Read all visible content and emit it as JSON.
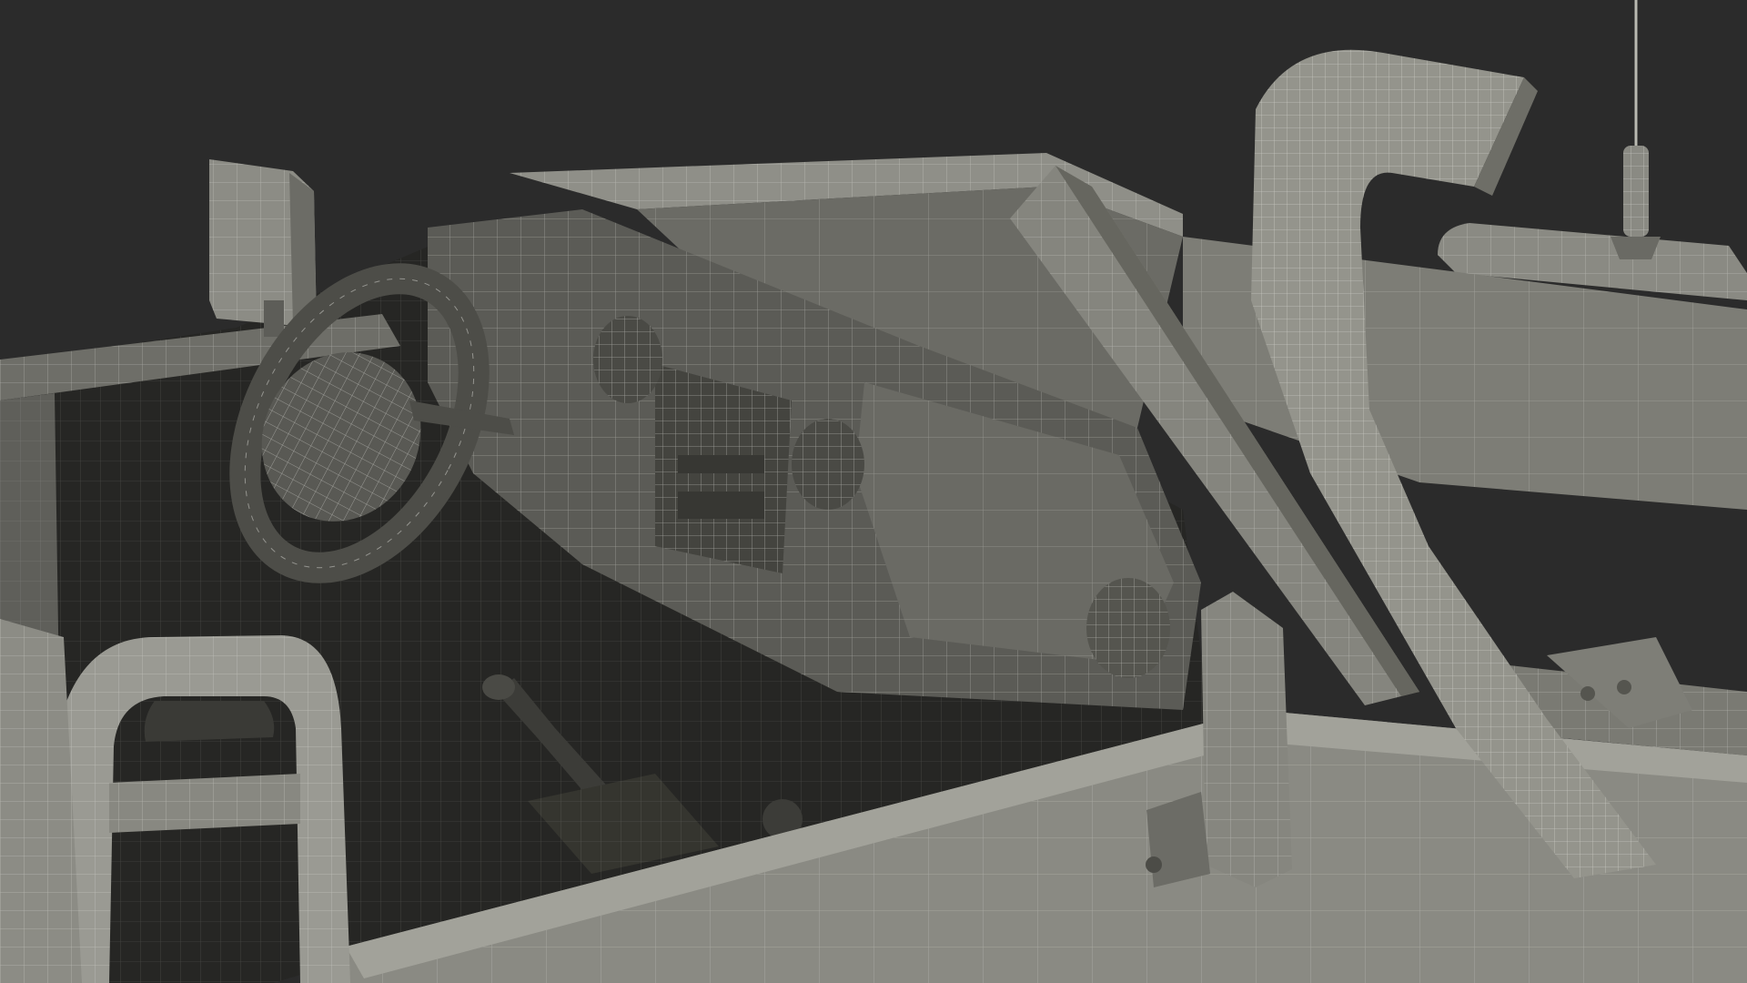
{
  "scene": {
    "subject": "wireframe-render-convertible-offroad-vehicle-interior",
    "colors": {
      "background": "#2b2b2b",
      "surface_light": "#9c9c94",
      "surface_mid": "#7c7c75",
      "surface_dark": "#4f4f4a",
      "cabin_shadow": "#262624",
      "wire": "#ecece6"
    },
    "parts": [
      "side-mirror-left",
      "windshield-frame",
      "windshield-pillar",
      "dashboard",
      "steering-wheel",
      "air-vent",
      "radio-console",
      "gear-shifter",
      "seat-headrest",
      "snorkel-intake",
      "antenna",
      "roll-bar",
      "door-panel",
      "side-mirror-right"
    ]
  }
}
